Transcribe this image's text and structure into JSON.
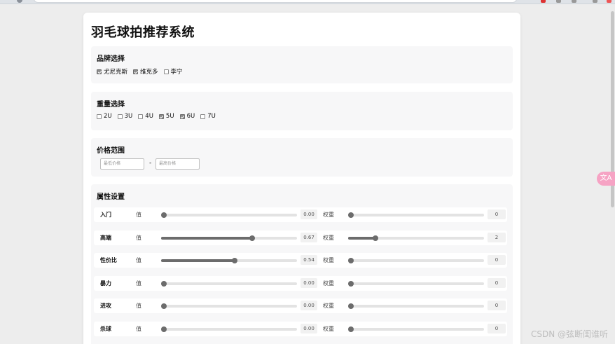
{
  "page": {
    "title": "羽毛球拍推荐系统"
  },
  "brand": {
    "title": "品牌选择",
    "options": [
      {
        "label": "尤尼克斯",
        "checked": true
      },
      {
        "label": "维克多",
        "checked": true
      },
      {
        "label": "李宁",
        "checked": false
      }
    ]
  },
  "weight": {
    "title": "重量选择",
    "options": [
      {
        "label": "2U",
        "checked": false
      },
      {
        "label": "3U",
        "checked": false
      },
      {
        "label": "4U",
        "checked": false
      },
      {
        "label": "5U",
        "checked": true
      },
      {
        "label": "6U",
        "checked": true
      },
      {
        "label": "7U",
        "checked": false
      }
    ]
  },
  "price": {
    "title": "价格范围",
    "min_placeholder": "最低价格",
    "max_placeholder": "最高价格",
    "separator": "-"
  },
  "attributes": {
    "title": "属性设置",
    "value_label": "值",
    "weight_label": "权重",
    "rows": [
      {
        "name": "入门",
        "value": 0.0,
        "value_text": "0.00",
        "weight": 0,
        "weight_text": "0"
      },
      {
        "name": "高端",
        "value": 0.67,
        "value_text": "0.67",
        "weight": 2,
        "weight_text": "2"
      },
      {
        "name": "性价比",
        "value": 0.54,
        "value_text": "0.54",
        "weight": 0,
        "weight_text": "0"
      },
      {
        "name": "暴力",
        "value": 0.0,
        "value_text": "0.00",
        "weight": 0,
        "weight_text": "0"
      },
      {
        "name": "进攻",
        "value": 0.0,
        "value_text": "0.00",
        "weight": 0,
        "weight_text": "0"
      },
      {
        "name": "杀球",
        "value": 0.0,
        "value_text": "0.00",
        "weight": 0,
        "weight_text": "0"
      }
    ],
    "weight_max": 10
  },
  "side_badge": "文A",
  "watermark": "CSDN @弦断闺谁听"
}
